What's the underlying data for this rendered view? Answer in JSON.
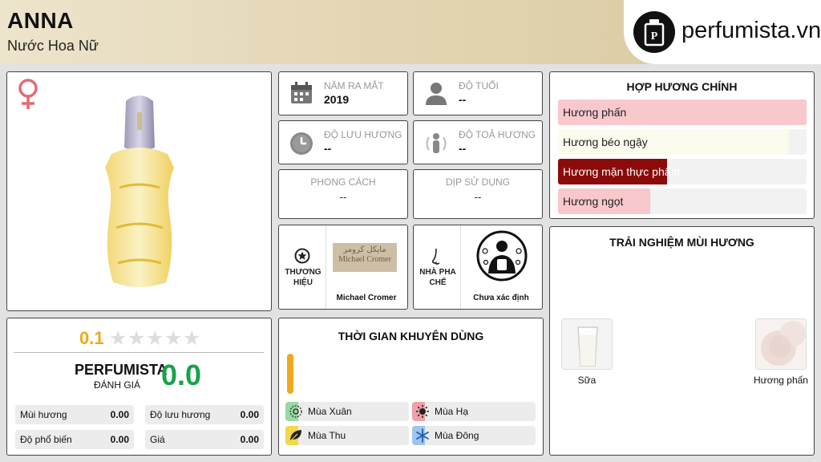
{
  "header": {
    "title": "ANNA",
    "subtitle": "Nước Hoa Nữ",
    "brand_logo_text": "perfumista.vn",
    "brand_logo_icon": "perfume-bottle-icon"
  },
  "product": {
    "gender_icon": "female-icon",
    "gender_color": "#e56a72",
    "image": "perfume-bottle-photo"
  },
  "info": {
    "year": {
      "label": "NĂM RA MẮT",
      "value": "2019",
      "icon": "calendar-icon"
    },
    "age": {
      "label": "ĐỘ TUỔI",
      "value": "--",
      "icon": "person-icon"
    },
    "longevity": {
      "label": "ĐỘ LƯU HƯƠNG",
      "value": "--",
      "icon": "clock-icon"
    },
    "sillage": {
      "label": "ĐỘ TOẢ HƯƠNG",
      "value": "--",
      "icon": "sillage-icon"
    },
    "style": {
      "label": "PHONG CÁCH",
      "value": "--"
    },
    "occasion": {
      "label": "DỊP SỬ DỤNG",
      "value": "--"
    }
  },
  "brand": {
    "label": "THƯƠNG HIỆU",
    "name": "Michael Cromer",
    "logo_text_arabic": "مايكل كرومر",
    "logo_text": "Michael Cromer",
    "icon": "star-badge-icon"
  },
  "perfumer": {
    "label": "NHÀ PHA CHẾ",
    "name": "Chưa xác định",
    "icon": "nose-icon"
  },
  "accords": {
    "title": "HỢP HƯƠNG CHÍNH",
    "items": [
      {
        "label": "Hương phấn",
        "fill": 1.0,
        "color": "#f8c8cc",
        "text_color": "#222222"
      },
      {
        "label": "Hương béo ngậy",
        "fill": 0.93,
        "color": "#fbfbee",
        "text_color": "#222222"
      },
      {
        "label": "Hương mặn thực phẩm",
        "fill": 0.44,
        "color": "#8b0a0a",
        "text_color": "#ffffff"
      },
      {
        "label": "Hương ngọt",
        "fill": 0.37,
        "color": "#f8c8cc",
        "text_color": "#222222"
      }
    ]
  },
  "experience": {
    "title": "TRẢI NGHIỆM MÙI HƯƠNG",
    "items": [
      {
        "label": "Sữa",
        "image": "milk-glass-photo"
      },
      {
        "label": "Hương phấn",
        "image": "powder-photo"
      }
    ]
  },
  "rating": {
    "score": "0.1",
    "stars_total": 5,
    "perfumista_label": "PERFUMISTA",
    "perfumista_sub": "ĐÁNH GIÁ",
    "perfumista_score": "0.0",
    "metrics": [
      {
        "label": "Mùi hương",
        "value": "0.00"
      },
      {
        "label": "Độ lưu hương",
        "value": "0.00"
      },
      {
        "label": "Độ phổ biến",
        "value": "0.00"
      },
      {
        "label": "Giá",
        "value": "0.00"
      }
    ]
  },
  "recommend": {
    "title": "THỜI GIAN KHUYÊN DÙNG",
    "seasons": [
      {
        "label": "Mùa Xuân",
        "color": "#9ad8a4",
        "icon": "spring-flower-icon"
      },
      {
        "label": "Mùa Hạ",
        "color": "#f0a0a8",
        "icon": "sun-icon"
      },
      {
        "label": "Mùa Thu",
        "color": "#f3d84a",
        "icon": "leaf-icon"
      },
      {
        "label": "Mùa Đông",
        "color": "#9fc4ee",
        "icon": "snowflake-icon"
      }
    ]
  }
}
